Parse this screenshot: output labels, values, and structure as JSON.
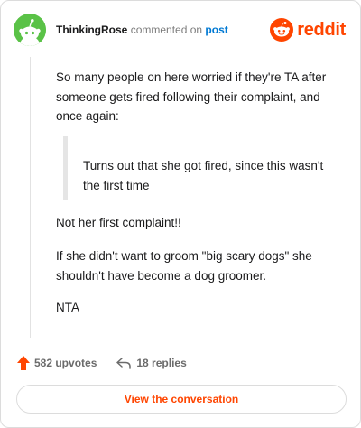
{
  "header": {
    "username": "ThinkingRose",
    "action_text": "commented on",
    "post_link": "post",
    "logo_text": "reddit"
  },
  "comment": {
    "paragraph_1": "So many people on here worried if they're TA after someone gets fired following their complaint, and once again:",
    "quote": "Turns out that she got fired, since this wasn't the first time",
    "paragraph_2": "Not her first complaint!!",
    "paragraph_3": "If she didn't want to groom \"big scary dogs\" she shouldn't have become a dog groomer.",
    "paragraph_4": "NTA"
  },
  "footer": {
    "upvotes": "582 upvotes",
    "replies": "18 replies",
    "cta": "View the conversation"
  },
  "colors": {
    "accent": "#ff4500",
    "link": "#0079d3",
    "avatar_bg": "#5ac247"
  },
  "icons": [
    "snoo-avatar-icon",
    "reddit-logo-icon",
    "upvote-arrow-icon",
    "reply-arrow-icon"
  ]
}
